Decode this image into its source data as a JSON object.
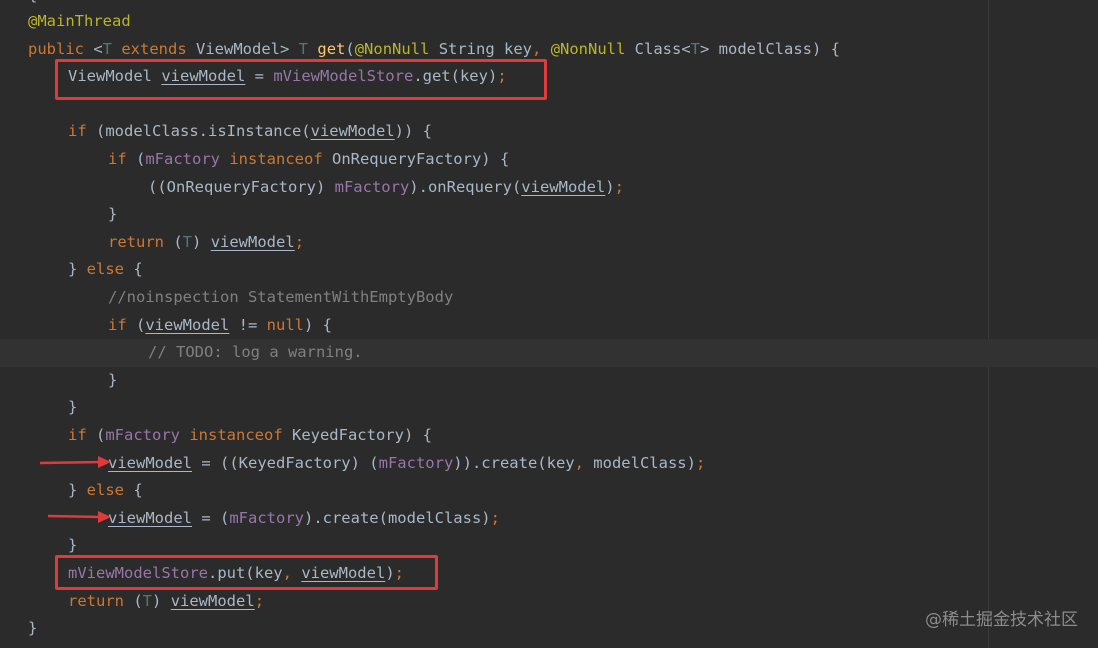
{
  "lines": [
    {
      "segs": [
        [
          "ann",
          "@MainThread"
        ]
      ]
    },
    {
      "segs": [
        [
          "kw",
          "public "
        ],
        [
          "p",
          "<"
        ],
        [
          "tp",
          "T"
        ],
        [
          "kw",
          " extends "
        ],
        [
          "p",
          "ViewModel> "
        ],
        [
          "tp",
          "T"
        ],
        [
          "p",
          " "
        ],
        [
          "mth",
          "get"
        ],
        [
          "p",
          "("
        ],
        [
          "ann",
          "@NonNull"
        ],
        [
          "p",
          " String key"
        ],
        [
          "kw",
          ", "
        ],
        [
          "ann",
          "@NonNull"
        ],
        [
          "p",
          " Class<"
        ],
        [
          "tp",
          "T"
        ],
        [
          "p",
          "> modelClass) {"
        ]
      ]
    },
    {
      "segs": [
        [
          "p",
          "ViewModel "
        ],
        [
          "var",
          "viewModel"
        ],
        [
          "p",
          " = "
        ],
        [
          "fld",
          "mViewModelStore"
        ],
        [
          "p",
          ".get(key)"
        ],
        [
          "kw",
          ";"
        ]
      ]
    },
    {
      "segs": []
    },
    {
      "segs": [
        [
          "kw",
          "if "
        ],
        [
          "p",
          "(modelClass.isInstance("
        ],
        [
          "var",
          "viewModel"
        ],
        [
          "p",
          ")) {"
        ]
      ]
    },
    {
      "segs": [
        [
          "kw",
          "if "
        ],
        [
          "p",
          "("
        ],
        [
          "fld",
          "mFactory"
        ],
        [
          "kw",
          " instanceof "
        ],
        [
          "p",
          "OnRequeryFactory) {"
        ]
      ]
    },
    {
      "segs": [
        [
          "p",
          "((OnRequeryFactory) "
        ],
        [
          "fld",
          "mFactory"
        ],
        [
          "p",
          ").onRequery("
        ],
        [
          "var",
          "viewModel"
        ],
        [
          "p",
          ")"
        ],
        [
          "kw",
          ";"
        ]
      ]
    },
    {
      "segs": [
        [
          "p",
          "}"
        ]
      ]
    },
    {
      "segs": [
        [
          "kw",
          "return "
        ],
        [
          "p",
          "("
        ],
        [
          "tp",
          "T"
        ],
        [
          "p",
          ") "
        ],
        [
          "var",
          "viewModel"
        ],
        [
          "kw",
          ";"
        ]
      ]
    },
    {
      "segs": [
        [
          "p",
          "} "
        ],
        [
          "kw",
          "else "
        ],
        [
          "p",
          "{"
        ]
      ]
    },
    {
      "segs": [
        [
          "cmt",
          "//noinspection StatementWithEmptyBody"
        ]
      ]
    },
    {
      "segs": [
        [
          "kw",
          "if "
        ],
        [
          "p",
          "("
        ],
        [
          "var",
          "viewModel"
        ],
        [
          "p",
          " != "
        ],
        [
          "kw",
          "null"
        ],
        [
          "p",
          ") {"
        ]
      ]
    },
    {
      "segs": [
        [
          "cmt",
          "// TODO: log a warning."
        ]
      ]
    },
    {
      "segs": [
        [
          "p",
          "}"
        ]
      ]
    },
    {
      "segs": [
        [
          "p",
          "}"
        ]
      ]
    },
    {
      "segs": [
        [
          "kw",
          "if "
        ],
        [
          "p",
          "("
        ],
        [
          "fld",
          "mFactory"
        ],
        [
          "kw",
          " instanceof "
        ],
        [
          "p",
          "KeyedFactory) {"
        ]
      ]
    },
    {
      "segs": [
        [
          "var",
          "viewModel"
        ],
        [
          "p",
          " = ((KeyedFactory) ("
        ],
        [
          "fld",
          "mFactory"
        ],
        [
          "p",
          ")).create(key"
        ],
        [
          "kw",
          ", "
        ],
        [
          "p",
          "modelClass)"
        ],
        [
          "kw",
          ";"
        ]
      ]
    },
    {
      "segs": [
        [
          "p",
          "} "
        ],
        [
          "kw",
          "else "
        ],
        [
          "p",
          "{"
        ]
      ]
    },
    {
      "segs": [
        [
          "var",
          "viewModel"
        ],
        [
          "p",
          " = ("
        ],
        [
          "fld",
          "mFactory"
        ],
        [
          "p",
          ").create(modelClass)"
        ],
        [
          "kw",
          ";"
        ]
      ]
    },
    {
      "segs": [
        [
          "p",
          "}"
        ]
      ]
    },
    {
      "segs": [
        [
          "fld",
          "mViewModelStore"
        ],
        [
          "p",
          ".put(key"
        ],
        [
          "kw",
          ", "
        ],
        [
          "var",
          "viewModel"
        ],
        [
          "p",
          ")"
        ],
        [
          "kw",
          ";"
        ]
      ]
    },
    {
      "segs": [
        [
          "kw",
          "return "
        ],
        [
          "p",
          "("
        ],
        [
          "tp",
          "T"
        ],
        [
          "p",
          ") "
        ],
        [
          "var",
          "viewModel"
        ],
        [
          "kw",
          ";"
        ]
      ]
    },
    {
      "segs": [
        [
          "p",
          "}"
        ]
      ]
    }
  ],
  "top_fragment": "{",
  "watermark": "@稀土掘金技术社区",
  "colors": {
    "highlight_box": "#e03a3a",
    "background": "#2b2b2b"
  }
}
